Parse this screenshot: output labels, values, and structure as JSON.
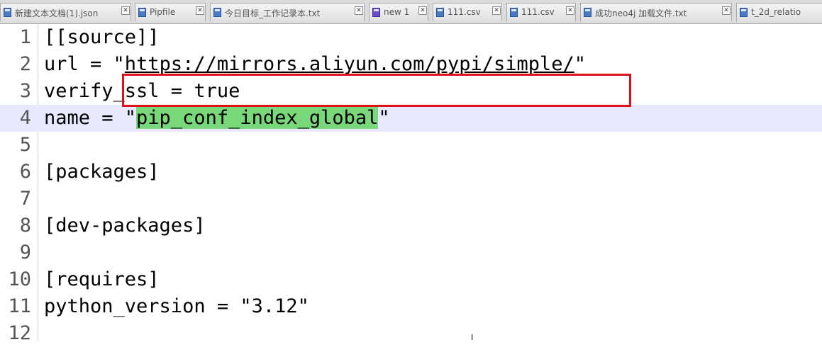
{
  "tabs": [
    {
      "label": "新建文本文档(1).json"
    },
    {
      "label": "Pipfile"
    },
    {
      "label": "今日目标_工作记录本.txt"
    },
    {
      "label": "new 1"
    },
    {
      "label": "111.csv"
    },
    {
      "label": "111.csv"
    },
    {
      "label": "成功neo4j 加载文件.txt"
    },
    {
      "label": "t_2d_relatio"
    }
  ],
  "colors": {
    "active_line": "#e8e8ff",
    "selection_highlight": "#79d879",
    "annotation_box": "#e0101a"
  },
  "editor": {
    "lines": [
      {
        "no": "1",
        "text": "[[source]]"
      },
      {
        "no": "2",
        "pre": "url = \"",
        "url": "https://mirrors.aliyun.com/pypi/simple/",
        "post": "\""
      },
      {
        "no": "3",
        "text": "verify_ssl = true"
      },
      {
        "no": "4",
        "pre": "name = \"",
        "hl": "pip_conf_index_global",
        "post": "\""
      },
      {
        "no": "5",
        "text": ""
      },
      {
        "no": "6",
        "text": "[packages]"
      },
      {
        "no": "7",
        "text": ""
      },
      {
        "no": "8",
        "text": "[dev-packages]"
      },
      {
        "no": "9",
        "text": ""
      },
      {
        "no": "10",
        "text": "[requires]"
      },
      {
        "no": "11",
        "text": "python_version = \"3.12\""
      },
      {
        "no": "12",
        "text": ""
      }
    ]
  }
}
